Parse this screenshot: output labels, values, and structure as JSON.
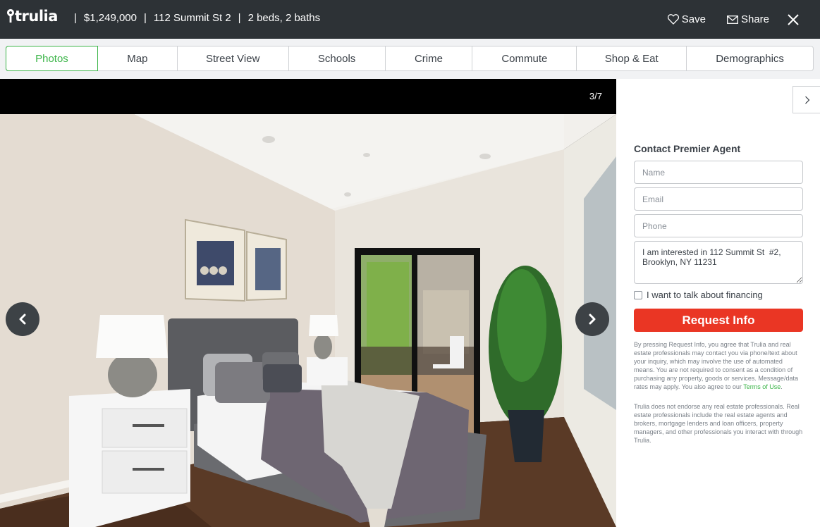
{
  "header": {
    "logo_text": "trulia",
    "price": "$1,249,000",
    "address": "112 Summit St 2",
    "beds_baths": "2 beds, 2 baths",
    "separator": "|",
    "save_label": "Save",
    "share_label": "Share",
    "icons": {
      "logo": "map-pin-icon",
      "save": "heart-icon",
      "share": "envelope-icon",
      "close": "close-icon"
    }
  },
  "tabs": [
    {
      "label": "Photos",
      "active": true
    },
    {
      "label": "Map",
      "active": false
    },
    {
      "label": "Street View",
      "active": false
    },
    {
      "label": "Schools",
      "active": false
    },
    {
      "label": "Crime",
      "active": false
    },
    {
      "label": "Commute",
      "active": false
    },
    {
      "label": "Shop & Eat",
      "active": false
    },
    {
      "label": "Demographics",
      "active": false
    }
  ],
  "gallery": {
    "counter": "3/7",
    "current": 3,
    "total": 7,
    "photo_description": "Bedroom with gray upholstered bed, white nightstands, lamps, framed art, balcony sliding door and potted plant"
  },
  "contact_form": {
    "title": "Contact Premier Agent",
    "name_placeholder": "Name",
    "email_placeholder": "Email",
    "phone_placeholder": "Phone",
    "message_value": "I am interested in 112 Summit St  #2, Brooklyn, NY 11231",
    "financing_label": "I want to talk about financing",
    "financing_checked": false,
    "submit_label": "Request Info",
    "legal_text": "By pressing Request Info, you agree that Trulia and real estate professionals may contact you via phone/text about your inquiry, which may involve the use of automated means. You are not required to consent as a condition of purchasing any property, goods or services. Message/data rates may apply. You also agree to our ",
    "terms_link": "Terms of Use",
    "legal_end": ".",
    "disclaimer": "Trulia does not endorse any real estate professionals. Real estate professionals include the real estate agents and brokers, mortgage lenders and loan officers, property managers, and other professionals you interact with through Trulia."
  },
  "colors": {
    "header_bg": "#2d3236",
    "accent_green": "#3cb549",
    "cta_red": "#ea3624",
    "tabbar_bg": "#f1f2f4"
  }
}
